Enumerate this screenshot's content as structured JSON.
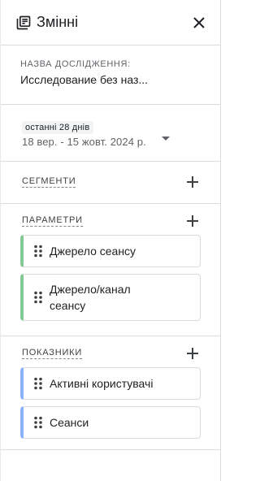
{
  "header": {
    "title": "Змінні",
    "title_icon": "library-books-icon",
    "close_icon": "close-icon"
  },
  "exploration_name": {
    "label": "НАЗВА ДОСЛІДЖЕННЯ:",
    "value": "Исследование без наз..."
  },
  "date_range": {
    "preset": "останні 28 днів",
    "range": "18 вер. - 15 жовт. 2024 р."
  },
  "segments": {
    "title": "СЕГМЕНТИ"
  },
  "dimensions": {
    "title": "ПАРАМЕТРИ",
    "items": [
      {
        "label": "Джерело сеансу",
        "color": "#81c995"
      },
      {
        "label": "Джерело/канал сеансу",
        "color": "#81c995"
      }
    ]
  },
  "metrics": {
    "title": "ПОКАЗНИКИ",
    "items": [
      {
        "label": "Активні користувачі",
        "color": "#8ab4f8"
      },
      {
        "label": "Сеанси",
        "color": "#8ab4f8"
      }
    ]
  }
}
